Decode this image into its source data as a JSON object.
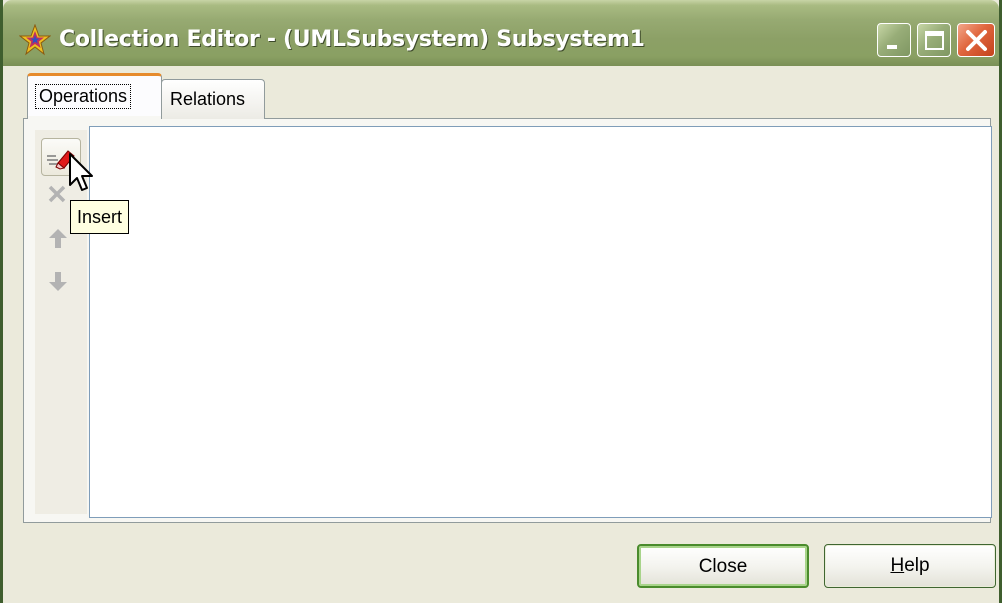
{
  "window": {
    "title": "Collection Editor - (UMLSubsystem) Subsystem1",
    "app_icon": "star-icon",
    "controls": {
      "minimize": "minimize-icon",
      "maximize": "maximize-icon",
      "close": "close-icon"
    }
  },
  "tabs": [
    {
      "label": "Operations",
      "selected": true
    },
    {
      "label": "Relations",
      "selected": false
    }
  ],
  "toolbar": {
    "items": [
      {
        "name": "insert",
        "icon": "insert-icon",
        "enabled": true
      },
      {
        "name": "delete",
        "icon": "delete-x-icon",
        "enabled": false
      },
      {
        "name": "move-up",
        "icon": "arrow-up-icon",
        "enabled": false
      },
      {
        "name": "move-down",
        "icon": "arrow-down-icon",
        "enabled": false
      }
    ]
  },
  "tooltip": {
    "text": "Insert"
  },
  "list": {
    "items": []
  },
  "buttons": {
    "close_label": "Close",
    "help_accel": "H",
    "help_rest": "elp"
  },
  "colors": {
    "title_bar": "#8ca066",
    "close_control": "#e0663e",
    "tab_highlight": "#e68b2c",
    "default_button_border": "#4a8b2c",
    "tooltip_bg": "#ffffe1"
  }
}
